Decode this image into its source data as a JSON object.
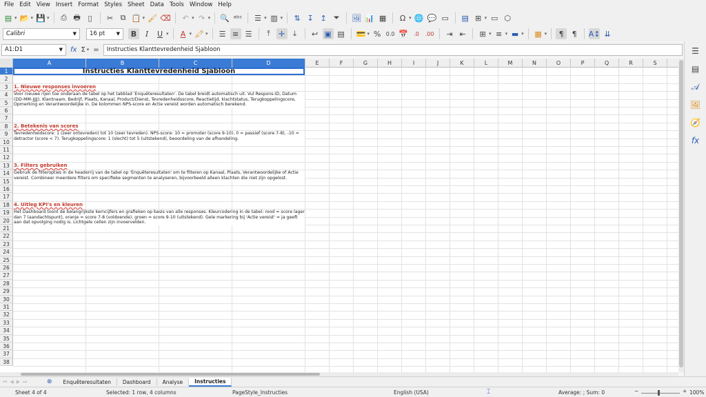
{
  "menu": [
    "File",
    "Edit",
    "View",
    "Insert",
    "Format",
    "Styles",
    "Sheet",
    "Data",
    "Tools",
    "Window",
    "Help"
  ],
  "toolbar": {
    "font_name": "Calibri",
    "font_size": "16 pt",
    "bold_label": "B",
    "italic_label": "I",
    "underline_label": "U",
    "percent_label": "%",
    "decimal_label": "0.0"
  },
  "formula_bar": {
    "name_box": "A1:D1",
    "fx": "fx",
    "sigma": "Σ",
    "equals": "=",
    "content": "Instructies Klanttevredenheid Sjabloon"
  },
  "columns": [
    "A",
    "B",
    "C",
    "D",
    "E",
    "F",
    "G",
    "H",
    "I",
    "J",
    "K",
    "L",
    "M",
    "N",
    "O",
    "P",
    "Q",
    "R",
    "S"
  ],
  "rows": [
    "1",
    "2",
    "3",
    "4",
    "5",
    "6",
    "7",
    "8",
    "9",
    "10",
    "11",
    "12",
    "13",
    "14",
    "15",
    "16",
    "17",
    "18",
    "19",
    "20",
    "21",
    "22",
    "23",
    "24",
    "25",
    "26",
    "27",
    "28",
    "29",
    "30",
    "31",
    "32",
    "33",
    "34",
    "35",
    "36",
    "37",
    "38"
  ],
  "sheet": {
    "title": "Instructies Klanttevredenheid Sjabloon",
    "sections": [
      {
        "heading": "1. Nieuwe responses invoeren",
        "body": "Voor nieuwe rijen toe onderaan de tabel op het tabblad 'Enquêteresultaten'. De tabel breidt automatisch uit. Vul Respons-ID, Datum (DD-MM-JJJJ), Klantnaam, Bedrijf, Plaats, Kanaal, Product/Dienst, Tevredenheidsscore, Reactietijd, klachtstatus, Terugkoppelingscore, Opmerking en Verantwoordelijke in. De kolommen NPS-score en Actie vereist worden automatisch berekend."
      },
      {
        "heading": "2. Betekenis van scores",
        "body": "Tevredenheidscore: 1 (zeer ontevreden) tot 10 (zeer tevreden). NPS-score: 10 = promoter (score 9-10), 0 = passief (score 7-8), -10 = detractor (score < 7). Terugkoppelingscore: 1 (slecht) tot 5 (uitstekend), beoordeling van de afhandeling."
      },
      {
        "heading": "3. Filters gebruiken",
        "body": "Gebruik de filteropties in de headerrij van de tabel op 'Enquêteresultaten' om te filteren op Kanaal, Plaats, Verantwoordelijke of Actie vereist. Combineer meerdere filters om specifieke segmenten te analyseren, bijvoorbeeld alleen klachten die niet zijn opgelost."
      },
      {
        "heading": "4. Uitleg KPI's en kleuren",
        "body": "Het Dashboard toont de belangrijkste kerncijfers en grafieken op basis van alle responses. Kleurcodering in de tabel: rood = score lager dan 7 (aandachtspunt), oranje = score 7-8 (voldoende), groen = score 9-10 (uitstekend). Gele markering bij 'Actie vereist' = ja geeft aan dat opvolging nodig is. Lichtgele cellen zijn invoervelden."
      }
    ]
  },
  "tabs": {
    "add": "⊕",
    "items": [
      "Enquêteresultaten",
      "Dashboard",
      "Analyse",
      "Instructies"
    ],
    "active": "Instructies"
  },
  "status": {
    "sheet": "Sheet 4 of 4",
    "selection": "Selected: 1 row, 4 columns",
    "page_style": "PageStyle_Instructies",
    "language": "English (USA)",
    "summary": "Average: ; Sum: 0",
    "zoom": "100%"
  }
}
